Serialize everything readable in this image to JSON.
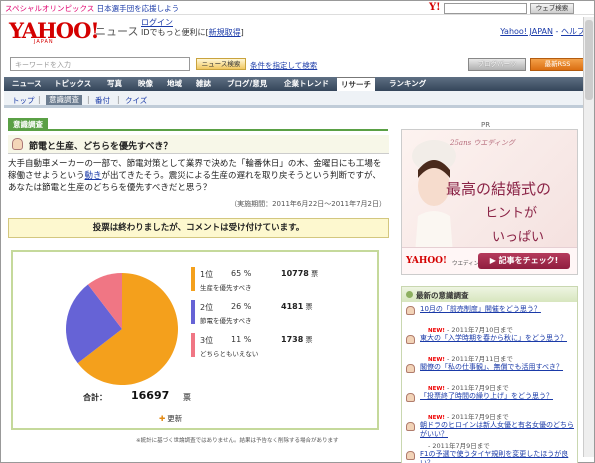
{
  "top": {
    "promo_prefix": "スペシャルオリンピックス",
    "promo_link": "日本選手団を応援しよう",
    "ylogo": "Y!",
    "search_button": "ウェブ検索"
  },
  "header": {
    "logo": "YAHOO!",
    "logo_sub": "JAPAN",
    "service": "ニュース",
    "login_link": "ログイン",
    "login_text_prefix": "IDでもっと便利に[",
    "register_link": "新規取得",
    "login_text_suffix": "]",
    "yahoo_link": "Yahoo! JAPAN",
    "help_link": "ヘルプ"
  },
  "search": {
    "placeholder": "キーワードを入力",
    "button": "ニュース検索",
    "condition_link": "条件を指定して検索",
    "blogparts": "ブログパーツ",
    "rss": "最新RSS"
  },
  "nav": {
    "items": [
      "ニュース",
      "トピックス",
      "写真",
      "映像",
      "地域",
      "雑誌",
      "ブログ/意見",
      "企業トレンド",
      "リサーチ",
      "ランキング"
    ]
  },
  "subnav": {
    "items": [
      "トップ",
      "意識調査",
      "番付",
      "クイズ"
    ]
  },
  "survey": {
    "section_label": "意識調査",
    "title": "節電と生産、どちらを優先すべき？",
    "body_before": "大手自動車メーカーの一部で、節電対策として業界で決めた「輪番休日」の木、金曜日にも工場を稼働させようという",
    "body_link": "動き",
    "body_after": "が出てきたそう。震災による生産の遅れを取り戻そうという判断ですが、あなたは節電と生産のどちらを優先すべきだと思う？",
    "period": "（実施期間：2011年6月22日〜2011年7月2日）",
    "closed_notice": "投票は終わりましたが、コメントは受け付けています。",
    "total_label": "合計：",
    "total_value": "16697",
    "total_unit": "票",
    "refresh": "更新",
    "footnote": "※統計に基づく世論調査ではありません。結果は予告なく削除する場合があります"
  },
  "chart_data": {
    "type": "pie",
    "categories": [
      "生産を優先すべき",
      "節電を優先すべき",
      "どちらともいえない"
    ],
    "values": [
      10778,
      4181,
      1738
    ],
    "percents": [
      65,
      26,
      11
    ],
    "ranks": [
      "1位",
      "2位",
      "3位"
    ],
    "colors": [
      "#f4a01c",
      "#6663d6",
      "#f07684"
    ],
    "count_unit": "票"
  },
  "sidebar": {
    "pr_label": "PR",
    "ad": {
      "line1": "25ans ウエディング",
      "line2": "最高の結婚式の",
      "line3": "ヒントが",
      "line4": "いっぱい",
      "footer_logo": "YAHOO!",
      "footer_label": "ウエディング",
      "cta": "記事をチェック!"
    },
    "latest_title": "最新の意識調査",
    "new_badge": "NEW!",
    "latest": [
      {
        "title": "10月の「前売制度」開催をどう思う？",
        "new": true,
        "date": "- 2011年7月10日まで"
      },
      {
        "title": "東大の「入学時期を春から秋に」をどう思う？",
        "new": true,
        "date": "- 2011年7月11日まで"
      },
      {
        "title": "閣僚の「私の仕事観」、無償でも活用すべき？",
        "new": true,
        "date": "- 2011年7月9日まで"
      },
      {
        "title": "「投票終了時間の繰り上げ」をどう思う？",
        "new": true,
        "date": "- 2011年7月9日まで"
      },
      {
        "title": "朝ドラのヒロインは新人女優と有名女優のどちらがいい？",
        "new": false,
        "date": "- 2011年7月9日まで"
      },
      {
        "title": "F1の予選で使うタイヤ規則を変更したほうが良い？",
        "new": false,
        "date": "- 2011年7月8日まで"
      }
    ]
  }
}
